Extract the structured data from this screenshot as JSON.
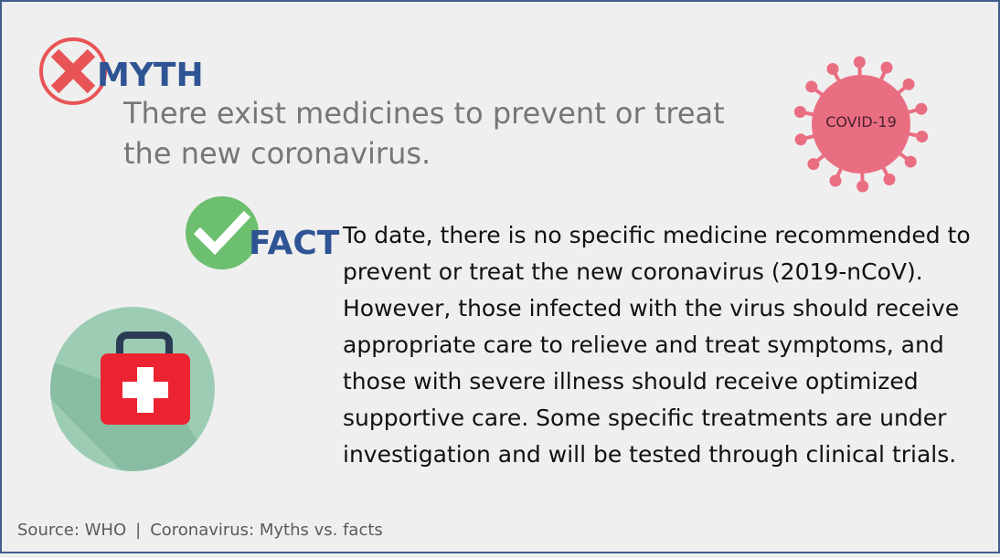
{
  "myth": {
    "label": "MYTH",
    "text": "There exist medicines to prevent or treat the new coronavirus."
  },
  "virus": {
    "label": "COVID-19"
  },
  "fact": {
    "label": "FACT",
    "text": "To date, there is no specific medicine recommended to prevent or treat the new coronavirus (2019-nCoV). However, those infected with the virus should receive appropriate care to relieve and treat symptoms, and those with severe illness should receive optimized supportive care. Some specific treatments are under investigation and will be tested through clinical trials."
  },
  "footer": {
    "source": "Source: WHO",
    "separator": "|",
    "title": "Coronavirus: Myths vs. facts"
  },
  "colors": {
    "accent_blue": "#2f5494",
    "myth_red": "#e85456",
    "fact_green": "#6cbf6e",
    "virus_pink": "#ea6e82",
    "kit_circle": "#9ccdb4",
    "kit_red": "#ec2330"
  },
  "icons": {
    "myth": "x-circle-icon",
    "fact": "check-circle-icon",
    "virus": "virus-icon",
    "kit": "first-aid-kit-icon"
  }
}
